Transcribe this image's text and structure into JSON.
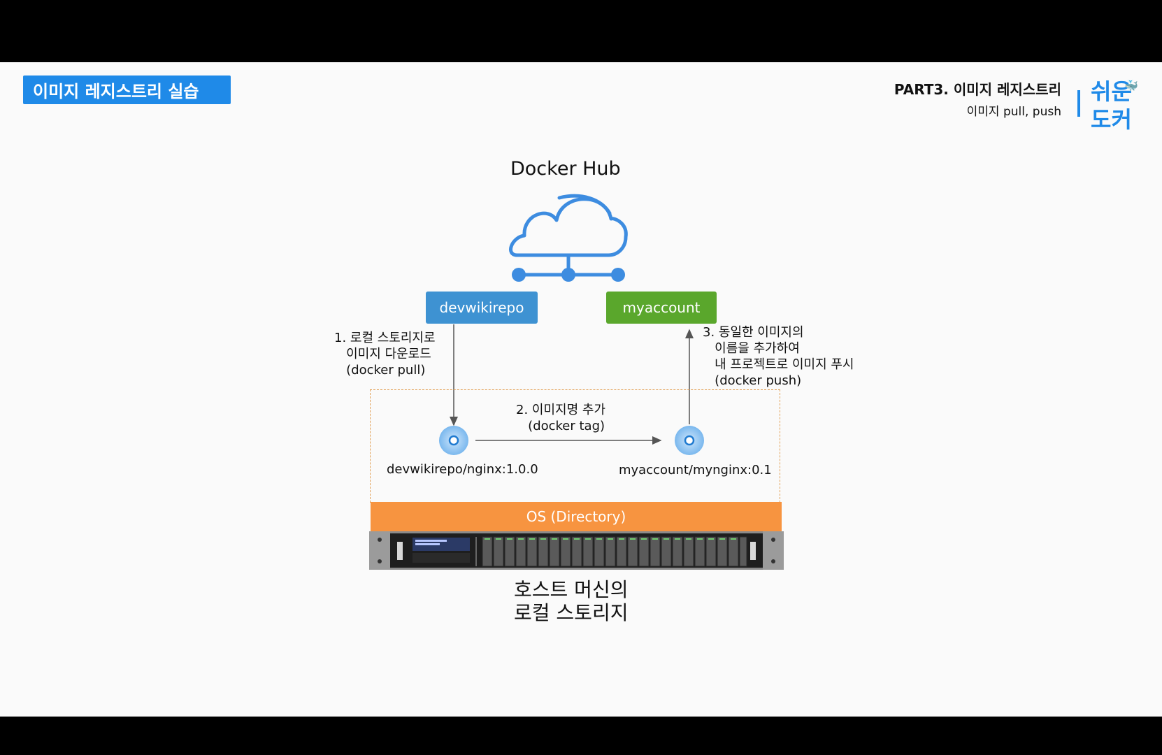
{
  "header": {
    "section_badge": "이미지 레지스트리 실습",
    "part_title": "PART3. 이미지 레지스트리",
    "part_subtitle": "이미지 pull, push",
    "brand_line1": "쉬운",
    "brand_line2": "도커"
  },
  "diagram": {
    "hub_title": "Docker Hub",
    "repo_left": "devwikirepo",
    "repo_right": "myaccount",
    "step1": "1. 로컬 스토리지로\n   이미지 다운로드\n   (docker pull)",
    "step2": "2. 이미지명 추가\n   (docker tag)",
    "step3": "3. 동일한 이미지의\n   이름을 추가하여\n   내 프로젝트로 이미지 푸시\n   (docker push)",
    "image_left": "devwikirepo/nginx:1.0.0",
    "image_right": "myaccount/mynginx:0.1",
    "os_label": "OS (Directory)",
    "host_label": "호스트 머신의\n로컬 스토리지"
  },
  "colors": {
    "accent_blue": "#1f8ae8",
    "repo_blue": "#3e92d2",
    "repo_green": "#5aa72c",
    "os_orange": "#f79440"
  }
}
